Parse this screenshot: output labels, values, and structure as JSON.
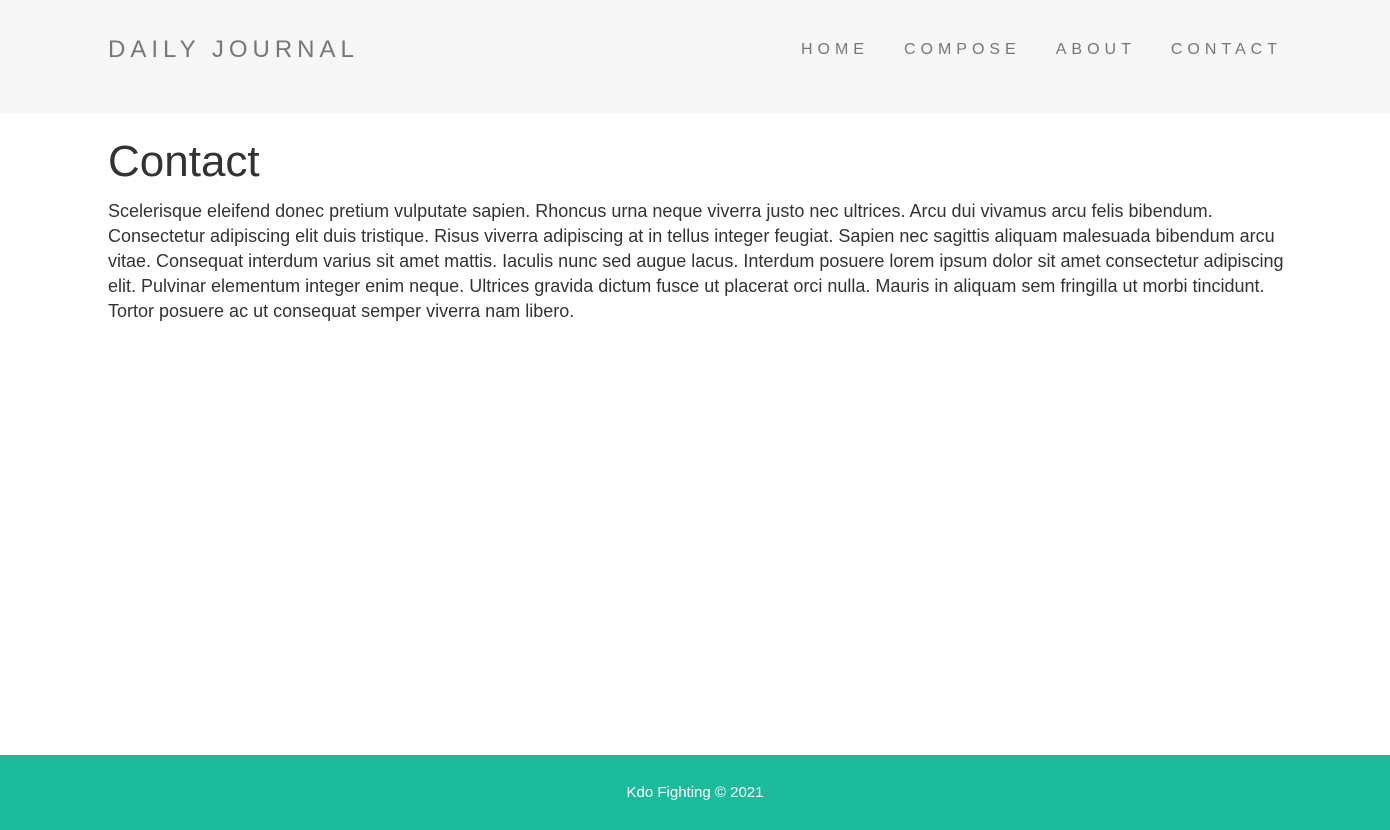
{
  "header": {
    "brand": "DAILY JOURNAL",
    "nav": [
      {
        "label": "HOME"
      },
      {
        "label": "COMPOSE"
      },
      {
        "label": "ABOUT"
      },
      {
        "label": "CONTACT"
      }
    ]
  },
  "main": {
    "title": "Contact",
    "body": "Scelerisque eleifend donec pretium vulputate sapien. Rhoncus urna neque viverra justo nec ultrices. Arcu dui vivamus arcu felis bibendum. Consectetur adipiscing elit duis tristique. Risus viverra adipiscing at in tellus integer feugiat. Sapien nec sagittis aliquam malesuada bibendum arcu vitae. Consequat interdum varius sit amet mattis. Iaculis nunc sed augue lacus. Interdum posuere lorem ipsum dolor sit amet consectetur adipiscing elit. Pulvinar elementum integer enim neque. Ultrices gravida dictum fusce ut placerat orci nulla. Mauris in aliquam sem fringilla ut morbi tincidunt. Tortor posuere ac ut consequat semper viverra nam libero."
  },
  "footer": {
    "text": "Kdo Fighting © 2021"
  },
  "colors": {
    "header_bg": "#f7f7f7",
    "nav_text": "#777777",
    "body_text": "#333333",
    "footer_bg": "#1abc9c",
    "footer_text": "#ffffff"
  }
}
